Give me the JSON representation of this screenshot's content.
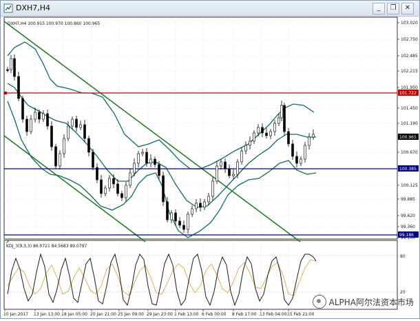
{
  "window": {
    "title": "DXH7,H4",
    "icon": "chart-icon",
    "buttons": [
      "minimize",
      "restore",
      "close"
    ]
  },
  "info_line": "DXH7,H4  100.915 100.970 100.860 100.965",
  "price_axis": {
    "ticks": [
      "103.020",
      "102.750",
      "102.485",
      "102.215",
      "101.950",
      "101.450",
      "101.190",
      "100.670",
      "100.125",
      "99.885",
      "99.620",
      "99.360",
      "99.100"
    ],
    "levels": [
      {
        "label": "101.722",
        "color": "#c00000"
      },
      {
        "label": "100.965",
        "color": "#000000"
      },
      {
        "label": "100.385",
        "color": "#000080"
      },
      {
        "label": "99.186",
        "color": "#000080"
      }
    ]
  },
  "time_axis": {
    "ticks": [
      "10 Jan 2017",
      "13 Jan 13:00",
      "18 Jan 05:00",
      "20 Jan 21:00",
      "25 Jan 09:00",
      "29 Jan 23:00",
      "1 Feb 13:00",
      "6 Feb 00:00",
      "8 Feb 17:00",
      "13 Feb 04:00",
      "15 Feb 21:00"
    ]
  },
  "indicator": {
    "label": "KDJ_3(9,3,3) 86.0721 84.5683 89.0797",
    "ticks": [
      "80",
      "20"
    ]
  },
  "watermark": "ALPHA阿尔法资本市场",
  "colors": {
    "candle": "#000000",
    "bollinger": "#0a6b6b",
    "channel": "#1a7a1a",
    "resistance": "#c00000",
    "support": "#000080",
    "k_line": "#1a1a1a",
    "d_line": "#d9b24a"
  }
}
